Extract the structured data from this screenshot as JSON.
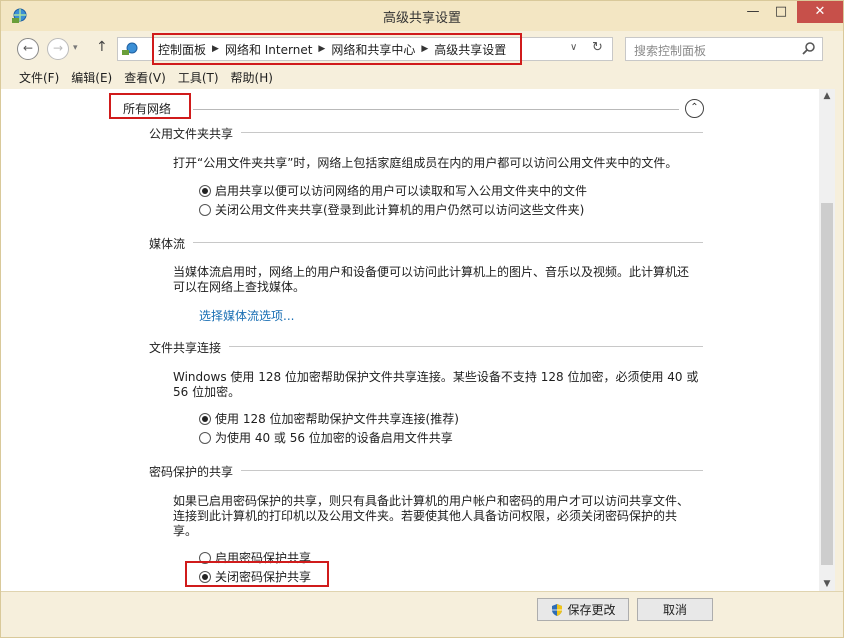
{
  "window": {
    "title": "高级共享设置",
    "min_label": "—",
    "max_label": "□",
    "close_label": "✕"
  },
  "nav": {
    "back": "←",
    "forward": "→",
    "up": "↑",
    "dropdown": "▾",
    "breadcrumbs": [
      "控制面板",
      "网络和 Internet",
      "网络和共享中心",
      "高级共享设置"
    ],
    "separator": "▶",
    "addr_dropdown": "∨",
    "refresh": "↻",
    "search_placeholder": "搜索控制面板"
  },
  "menu": [
    "文件(F)",
    "编辑(E)",
    "查看(V)",
    "工具(T)",
    "帮助(H)"
  ],
  "content": {
    "all_networks": "所有网络",
    "collapse": "⌃",
    "sections": {
      "public_folder": {
        "heading": "公用文件夹共享",
        "description": "打开“公用文件夹共享”时，网络上包括家庭组成员在内的用户都可以访问公用文件夹中的文件。",
        "options": [
          {
            "label": "启用共享以便可以访问网络的用户可以读取和写入公用文件夹中的文件",
            "selected": true
          },
          {
            "label": "关闭公用文件夹共享(登录到此计算机的用户仍然可以访问这些文件夹)",
            "selected": false
          }
        ]
      },
      "media": {
        "heading": "媒体流",
        "description_l1": "当媒体流启用时，网络上的用户和设备便可以访问此计算机上的图片、音乐以及视频。此计算机还",
        "description_l2": "可以在网络上查找媒体。",
        "link": "选择媒体流选项..."
      },
      "file_sharing": {
        "heading": "文件共享连接",
        "description_l1": "Windows 使用 128 位加密帮助保护文件共享连接。某些设备不支持 128 位加密，必须使用 40 或",
        "description_l2": "56 位加密。",
        "options": [
          {
            "label": "使用 128 位加密帮助保护文件共享连接(推荐)",
            "selected": true
          },
          {
            "label": "为使用 40 或 56 位加密的设备启用文件共享",
            "selected": false
          }
        ]
      },
      "password": {
        "heading": "密码保护的共享",
        "description_l1": "如果已启用密码保护的共享，则只有具备此计算机的用户帐户和密码的用户才可以访问共享文件、",
        "description_l2": "连接到此计算机的打印机以及公用文件夹。若要使其他人具备访问权限，必须关闭密码保护的共",
        "description_l3": "享。",
        "options": [
          {
            "label": "启用密码保护共享",
            "selected": false
          },
          {
            "label": "关闭密码保护共享",
            "selected": true
          }
        ]
      }
    }
  },
  "scrollbar": {
    "up": "▲",
    "down": "▼"
  },
  "footer": {
    "save_label": "保存更改",
    "cancel_label": "取消"
  },
  "colors": {
    "highlight": "#d01b1b",
    "link": "#1a6fb4",
    "titlebar": "#f3e6c3",
    "close": "#c7504a"
  }
}
